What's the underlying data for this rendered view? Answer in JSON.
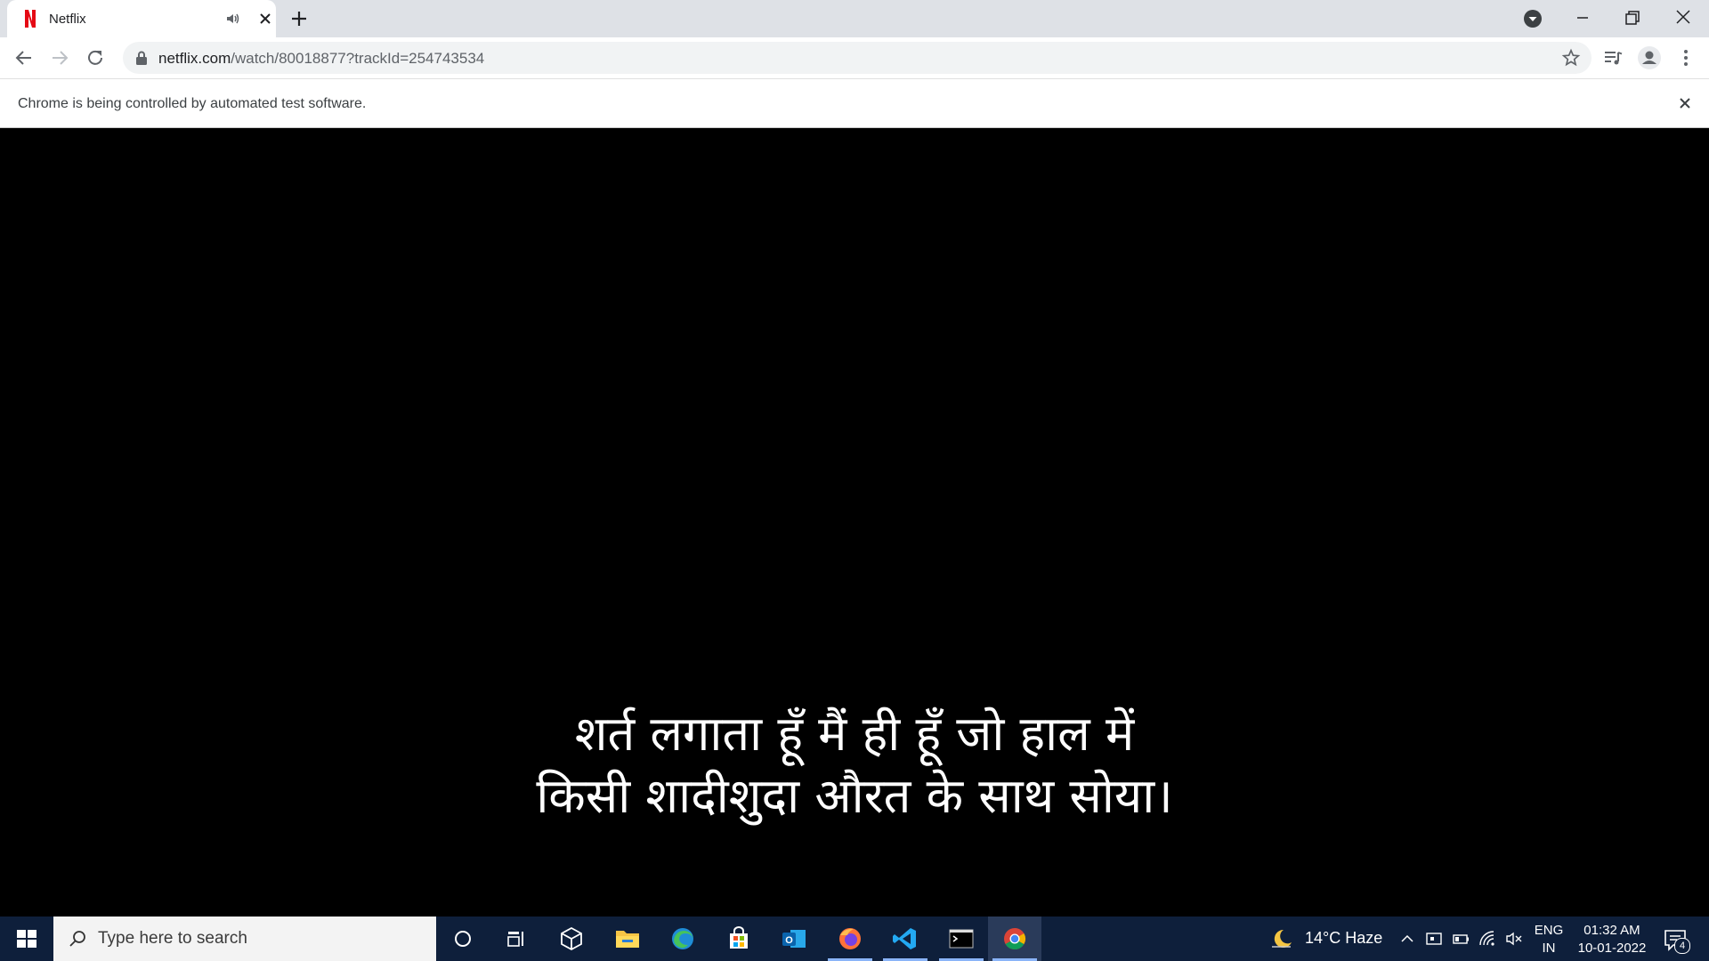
{
  "browser": {
    "tab": {
      "title": "Netflix",
      "favicon": "netflix-n-icon"
    },
    "address": {
      "host": "netflix.com",
      "path": "/watch/80018877?trackId=254743534"
    },
    "infobar": {
      "message": "Chrome is being controlled by automated test software."
    }
  },
  "video": {
    "subtitle_line1": "शर्त लगाता हूँ मैं ही हूँ जो हाल में",
    "subtitle_line2": "किसी शादीशुदा औरत के साथ सोया।"
  },
  "taskbar": {
    "search_placeholder": "Type here to search",
    "apps": [
      "cortana-icon",
      "task-view-icon",
      "widgets-icon",
      "file-explorer-icon",
      "edge-icon",
      "store-icon",
      "outlook-icon",
      "firefox-icon",
      "vscode-icon",
      "terminal-icon",
      "chrome-icon"
    ],
    "weather": "14°C  Haze",
    "language_top": "ENG",
    "language_bottom": "IN",
    "time": "01:32 AM",
    "date": "10-01-2022",
    "notification_count": "4"
  },
  "colors": {
    "netflix_red": "#e50914",
    "taskbar_bg": "#0e1f3b",
    "tabstrip_bg": "#dee1e6"
  }
}
